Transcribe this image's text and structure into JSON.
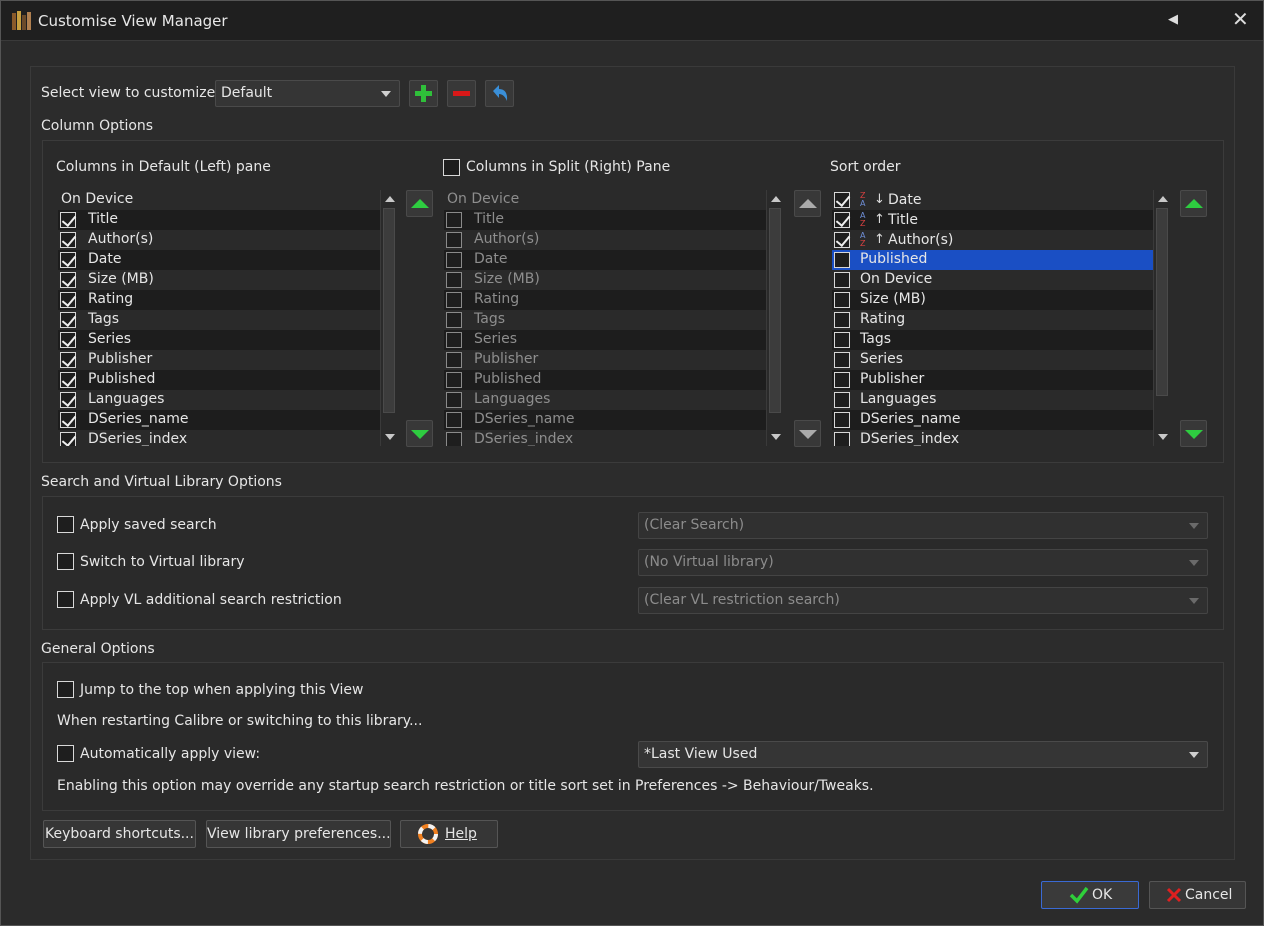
{
  "window": {
    "title": "Customise View Manager"
  },
  "view_select": {
    "label": "Select view to customize:",
    "value": "Default"
  },
  "column_options": {
    "title": "Column Options",
    "left_pane": {
      "label": "Columns in Default (Left) pane",
      "items": [
        {
          "label": "On Device",
          "checkable": false,
          "checked": false
        },
        {
          "label": "Title",
          "checkable": true,
          "checked": true
        },
        {
          "label": "Author(s)",
          "checkable": true,
          "checked": true
        },
        {
          "label": "Date",
          "checkable": true,
          "checked": true
        },
        {
          "label": "Size (MB)",
          "checkable": true,
          "checked": true
        },
        {
          "label": "Rating",
          "checkable": true,
          "checked": true
        },
        {
          "label": "Tags",
          "checkable": true,
          "checked": true
        },
        {
          "label": "Series",
          "checkable": true,
          "checked": true
        },
        {
          "label": "Publisher",
          "checkable": true,
          "checked": true
        },
        {
          "label": "Published",
          "checkable": true,
          "checked": true
        },
        {
          "label": "Languages",
          "checkable": true,
          "checked": true
        },
        {
          "label": "DSeries_name",
          "checkable": true,
          "checked": true
        },
        {
          "label": "DSeries_index",
          "checkable": true,
          "checked": true
        }
      ]
    },
    "right_pane": {
      "label": "Columns in Split (Right) Pane",
      "enabled": false,
      "items": [
        {
          "label": "On Device",
          "checkable": false,
          "checked": false
        },
        {
          "label": "Title",
          "checkable": true,
          "checked": false
        },
        {
          "label": "Author(s)",
          "checkable": true,
          "checked": false
        },
        {
          "label": "Date",
          "checkable": true,
          "checked": false
        },
        {
          "label": "Size (MB)",
          "checkable": true,
          "checked": false
        },
        {
          "label": "Rating",
          "checkable": true,
          "checked": false
        },
        {
          "label": "Tags",
          "checkable": true,
          "checked": false
        },
        {
          "label": "Series",
          "checkable": true,
          "checked": false
        },
        {
          "label": "Publisher",
          "checkable": true,
          "checked": false
        },
        {
          "label": "Published",
          "checkable": true,
          "checked": false
        },
        {
          "label": "Languages",
          "checkable": true,
          "checked": false
        },
        {
          "label": "DSeries_name",
          "checkable": true,
          "checked": false
        },
        {
          "label": "DSeries_index",
          "checkable": true,
          "checked": false
        }
      ]
    },
    "sort_order": {
      "label": "Sort order",
      "items": [
        {
          "label": "Date",
          "checked": true,
          "direction": "descending"
        },
        {
          "label": "Title",
          "checked": true,
          "direction": "ascending"
        },
        {
          "label": "Author(s)",
          "checked": true,
          "direction": "ascending"
        },
        {
          "label": "Published",
          "checked": false,
          "selected": true
        },
        {
          "label": "On Device",
          "checked": false
        },
        {
          "label": "Size (MB)",
          "checked": false
        },
        {
          "label": "Rating",
          "checked": false
        },
        {
          "label": "Tags",
          "checked": false
        },
        {
          "label": "Series",
          "checked": false
        },
        {
          "label": "Publisher",
          "checked": false
        },
        {
          "label": "Languages",
          "checked": false
        },
        {
          "label": "DSeries_name",
          "checked": false
        },
        {
          "label": "DSeries_index",
          "checked": false
        }
      ]
    }
  },
  "search_options": {
    "title": "Search and Virtual Library Options",
    "apply_saved_search": {
      "label": "Apply saved search",
      "checked": false,
      "value": "(Clear Search)"
    },
    "switch_vl": {
      "label": "Switch to Virtual library",
      "checked": false,
      "value": "(No Virtual library)"
    },
    "vl_restriction": {
      "label": "Apply VL additional search restriction",
      "checked": false,
      "value": "(Clear VL restriction search)"
    }
  },
  "general_options": {
    "title": "General Options",
    "jump_top": {
      "label": "Jump to the top when applying this View",
      "checked": false
    },
    "restart_note": "When restarting Calibre or switching to this library...",
    "auto_apply": {
      "label": "Automatically apply view:",
      "checked": false,
      "value": "*Last View Used"
    },
    "warning": "Enabling this option may override any startup search restriction or title sort set in Preferences -> Behaviour/Tweaks."
  },
  "bottom_buttons": {
    "keyboard": "Keyboard shortcuts...",
    "view_prefs": "View library preferences...",
    "help": "Help"
  },
  "dialog_buttons": {
    "ok": "OK",
    "cancel": "Cancel"
  },
  "colors": {
    "accent": "#1a4fc4",
    "green_arrow": "#2ecc40",
    "background": "#2b2b2b"
  }
}
